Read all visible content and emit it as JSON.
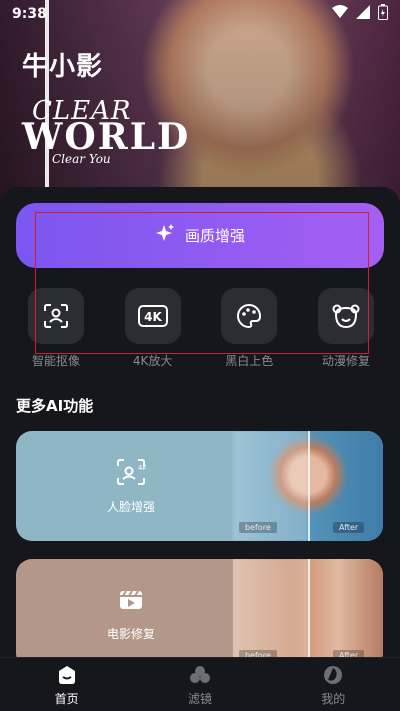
{
  "status_bar": {
    "time": "9:38"
  },
  "hero": {
    "app_title": "牛小影",
    "clear": "CLEAR",
    "world": "WORLD",
    "clear_you": "Clear You"
  },
  "enhance_button": {
    "label": "画质增强"
  },
  "tools": [
    {
      "label": "智能抠像",
      "icon": "portrait-scan-icon"
    },
    {
      "label": "4K放大",
      "icon": "4k-icon"
    },
    {
      "label": "黑白上色",
      "icon": "palette-icon"
    },
    {
      "label": "动漫修复",
      "icon": "bear-face-icon"
    }
  ],
  "more_section": {
    "title": "更多AI功能"
  },
  "cards": [
    {
      "label": "人脸增强",
      "icon": "face-enhance-icon",
      "before": "before",
      "after": "After"
    },
    {
      "label": "电影修复",
      "icon": "film-repair-icon",
      "before": "before",
      "after": "After"
    }
  ],
  "bottom_nav": [
    {
      "label": "首页",
      "icon": "home-icon",
      "active": true
    },
    {
      "label": "滤镜",
      "icon": "filter-icon",
      "active": false
    },
    {
      "label": "我的",
      "icon": "profile-icon",
      "active": false
    }
  ],
  "colors": {
    "accent_start": "#7b56f0",
    "accent_end": "#a45ff2",
    "panel_bg": "#16161d",
    "tool_bg": "#2c2c35",
    "highlight_box": "#d0202a"
  }
}
